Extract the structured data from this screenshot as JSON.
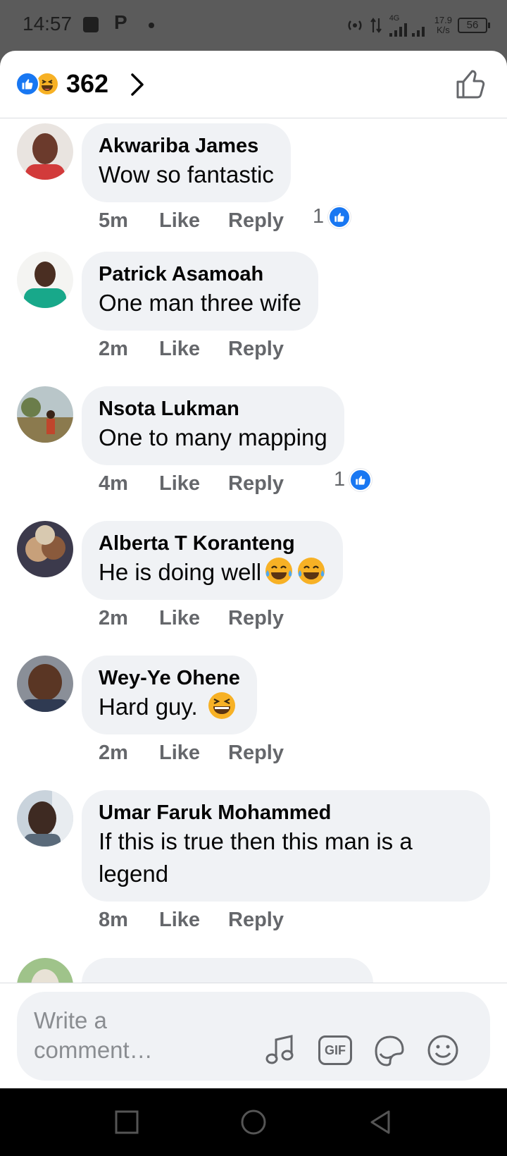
{
  "status": {
    "time": "14:57",
    "app_letter": "P",
    "network": "4G",
    "speed_value": "17.9",
    "speed_unit": "K/s",
    "battery": "56"
  },
  "header": {
    "reaction_count": "362"
  },
  "comments": [
    {
      "name": "Akwariba James",
      "text": "Wow so fantastic",
      "time": "5m",
      "like_label": "Like",
      "reply_label": "Reply",
      "reactions": "1",
      "avatar_color": "#c94a3c"
    },
    {
      "name": "Patrick Asamoah",
      "text": "One man three wife",
      "time": "2m",
      "like_label": "Like",
      "reply_label": "Reply",
      "reactions": "",
      "avatar_color": "#2aa88c"
    },
    {
      "name": "Nsota Lukman",
      "text": "One to many mapping",
      "time": "4m",
      "like_label": "Like",
      "reply_label": "Reply",
      "reactions": "1",
      "avatar_color": "#8a7f5a"
    },
    {
      "name": "Alberta T Koranteng",
      "text": "He is doing well",
      "time": "2m",
      "like_label": "Like",
      "reply_label": "Reply",
      "reactions": "",
      "avatar_color": "#4d4a5e"
    },
    {
      "name": "Wey-Ye Ohene",
      "text": "Hard guy.",
      "time": "2m",
      "like_label": "Like",
      "reply_label": "Reply",
      "reactions": "",
      "avatar_color": "#6e4a35"
    },
    {
      "name": "Umar Faruk Mohammed",
      "text": "If this is true then this man is a legend",
      "time": "8m",
      "like_label": "Like",
      "reply_label": "Reply",
      "reactions": "",
      "avatar_color": "#a9b7c4"
    }
  ],
  "composer": {
    "placeholder": "Write a comment…",
    "gif_label": "GIF"
  },
  "icons": {
    "header": [
      "like-reaction-icon",
      "haha-reaction-icon",
      "chevron-right-icon",
      "thumbs-up-icon"
    ],
    "composer": [
      "music-icon",
      "gif-icon",
      "sticker-icon",
      "emoji-icon"
    ],
    "nav": [
      "recents-icon",
      "home-icon",
      "back-icon"
    ]
  },
  "colors": {
    "brand_blue": "#1877f2",
    "bubble_bg": "#f0f2f5",
    "meta_gray": "#65676b",
    "haha_yellow": "#f7b125"
  }
}
